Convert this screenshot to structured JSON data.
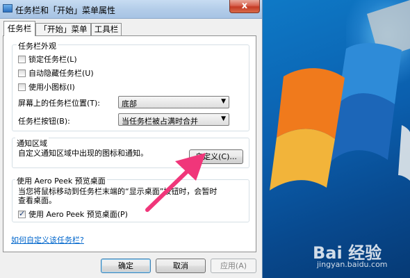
{
  "window": {
    "title": "任务栏和「开始」菜单属性",
    "close_label": "x"
  },
  "tabs": [
    {
      "label": "任务栏"
    },
    {
      "label": "「开始」菜单"
    },
    {
      "label": "工具栏"
    }
  ],
  "appearance": {
    "title": "任务栏外观",
    "lock_label": "锁定任务栏(L)",
    "lock_checked": false,
    "autohide_label": "自动隐藏任务栏(U)",
    "autohide_checked": false,
    "small_icons_label": "使用小图标(I)",
    "small_icons_checked": false,
    "location_label": "屏幕上的任务栏位置(T):",
    "location_value": "底部",
    "buttons_label": "任务栏按钮(B):",
    "buttons_value": "当任务栏被占满时合并"
  },
  "notification": {
    "title": "通知区域",
    "description": "自定义通知区域中出现的图标和通知。",
    "customize_button": "自定义(C)..."
  },
  "aero_peek": {
    "title": "使用 Aero Peek 预览桌面",
    "description_line1": "当您将鼠标移动到任务栏末端的“显示桌面”按钮时，会暂时",
    "description_line2": "查看桌面。",
    "checkbox_label": "使用 Aero Peek 预览桌面(P)",
    "checkbox_checked": true
  },
  "help_link": "如何自定义该任务栏?",
  "footer": {
    "ok": "确定",
    "cancel": "取消",
    "apply": "应用(A)"
  },
  "watermark": {
    "brand": "Bai 经验",
    "url": "jingyan.baidu.com"
  },
  "colors": {
    "annotation_arrow": "#f0367a",
    "desktop_blue": "#0b5fae"
  }
}
